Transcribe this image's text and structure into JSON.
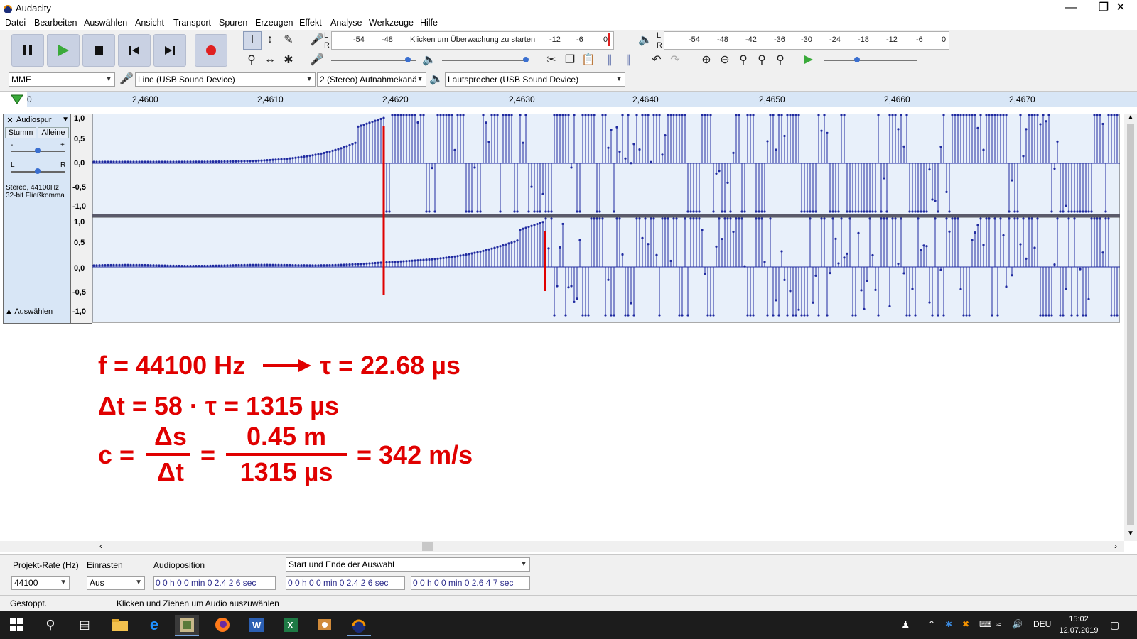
{
  "window": {
    "title": "Audacity",
    "min_icon": "minimize-icon",
    "max_icon": "maximize-icon",
    "close_icon": "close-icon"
  },
  "menu": [
    "Datei",
    "Bearbeiten",
    "Auswählen",
    "Ansicht",
    "Transport",
    "Spuren",
    "Erzeugen",
    "Effekt",
    "Analyse",
    "Werkzeuge",
    "Hilfe"
  ],
  "meters": {
    "record_ticks": [
      "-54",
      "-48",
      "-12",
      "-6",
      "0"
    ],
    "record_hint": "Klicken um Überwachung zu starten",
    "play_ticks": [
      "-54",
      "-48",
      "-42",
      "-36",
      "-30",
      "-24",
      "-18",
      "-12",
      "-6",
      "0"
    ],
    "lr_l": "L",
    "lr_r": "R"
  },
  "devices": {
    "host": "MME",
    "input": "Line (USB Sound Device)",
    "channels": "2 (Stereo) Aufnahmekanä",
    "output": "Lautsprecher (USB Sound Device)"
  },
  "ruler": {
    "first_label": "0",
    "ticks": [
      "2,4600",
      "2,4610",
      "2,4620",
      "2,4630",
      "2,4640",
      "2,4650",
      "2,4660",
      "2,4670"
    ]
  },
  "track": {
    "name": "Audiospur",
    "mute": "Stumm",
    "solo": "Alleine",
    "gain_minus": "-",
    "gain_plus": "+",
    "pan_l": "L",
    "pan_r": "R",
    "info_line1": "Stereo, 44100Hz",
    "info_line2": "32-bit Fließkomma",
    "select": "Auswählen",
    "y_labels": [
      "1,0",
      "0,5",
      "0,0",
      "-0,5",
      "-1,0"
    ]
  },
  "annotation": {
    "line1_left": "f = 44100 Hz",
    "line1_right": "τ = 22.68 µs",
    "line2": "Δt = 58 · τ = 1315 µs",
    "line3_c": "c =",
    "frac1_num": "Δs",
    "frac1_den": "Δt",
    "equals": "=",
    "frac2_num": "0.45 m",
    "frac2_den": "1315 µs",
    "line3_result": "= 342 m/s"
  },
  "selection_bar": {
    "rate_label": "Projekt-Rate (Hz)",
    "rate_value": "44100",
    "snap_label": "Einrasten",
    "snap_value": "Aus",
    "position_label": "Audioposition",
    "position_value": "0 0 h 0 0 min 0 2.4 2 6 sec",
    "selection_mode": "Start und Ende der Auswahl",
    "start_value": "0 0 h 0 0 min 0 2.4 2 6 sec",
    "end_value": "0 0 h 0 0 min 0 2.6 4 7 sec"
  },
  "status": {
    "state": "Gestoppt.",
    "hint": "Klicken und Ziehen um Audio auszuwählen"
  },
  "taskbar": {
    "language": "DEU",
    "time": "15:02",
    "date": "12.07.2019"
  },
  "colors": {
    "wave": "#1f2aa0",
    "wave_bg": "#e8f0fa",
    "annotation": "#e00000",
    "record": "#e02020",
    "play": "#3aaa3a"
  }
}
